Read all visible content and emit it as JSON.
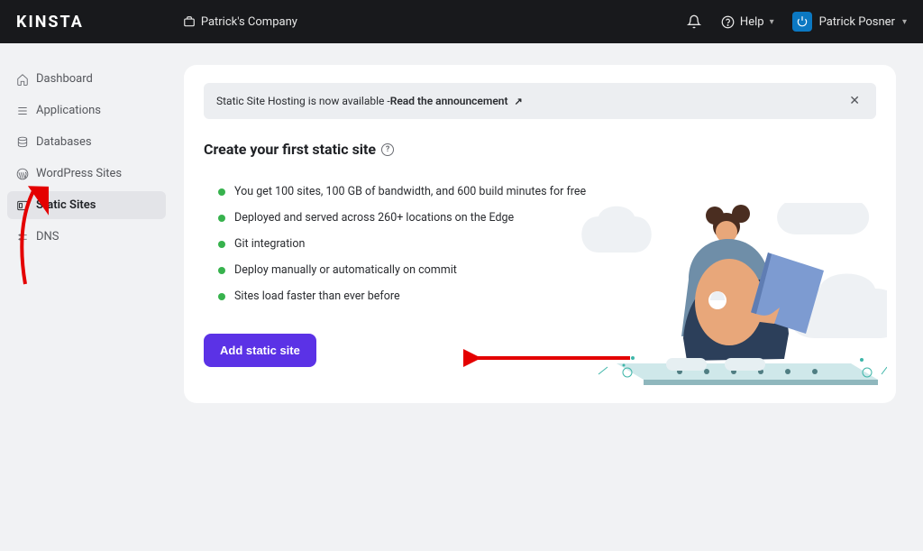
{
  "header": {
    "logo": "KINSTA",
    "company": "Patrick's Company",
    "help_label": "Help",
    "user_name": "Patrick Posner"
  },
  "sidebar": {
    "items": [
      {
        "label": "Dashboard",
        "icon": "home"
      },
      {
        "label": "Applications",
        "icon": "stack"
      },
      {
        "label": "Databases",
        "icon": "database"
      },
      {
        "label": "WordPress Sites",
        "icon": "wordpress"
      },
      {
        "label": "Static Sites",
        "icon": "panel"
      },
      {
        "label": "DNS",
        "icon": "dns"
      }
    ]
  },
  "banner": {
    "text_prefix": "Static Site Hosting is now available - ",
    "link_text": "Read the announcement"
  },
  "page": {
    "title": "Create your first static site",
    "features": [
      "You get 100 sites, 100 GB of bandwidth, and 600 build minutes for free",
      "Deployed and served across 260+ locations on the Edge",
      "Git integration",
      "Deploy manually or automatically on commit",
      "Sites load faster than ever before"
    ],
    "add_button": "Add static site"
  }
}
